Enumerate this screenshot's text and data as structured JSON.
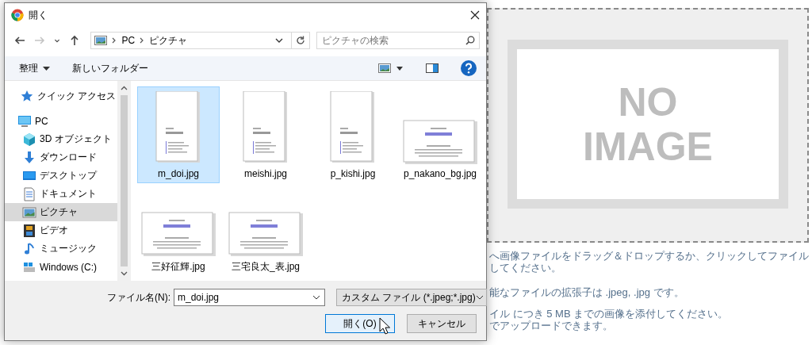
{
  "window": {
    "title": "開く"
  },
  "nav_buttons": [
    {
      "kind": "back",
      "disabled": false
    },
    {
      "kind": "forward",
      "disabled": true
    },
    {
      "kind": "recent",
      "disabled": false
    },
    {
      "kind": "up",
      "disabled": false
    }
  ],
  "address": {
    "path": [
      "PC",
      "ピクチャ"
    ]
  },
  "search": {
    "placeholder": "ピクチャの検索"
  },
  "toolbar": {
    "organize": "整理",
    "new_folder": "新しいフォルダー"
  },
  "sidebar": {
    "items": [
      {
        "label": "クイック アクセス",
        "kind": "star",
        "selected": false
      },
      {
        "label": "PC",
        "kind": "pc",
        "selected": false,
        "children": [
          {
            "label": "3D オブジェクト",
            "kind": "cube",
            "selected": false
          },
          {
            "label": "ダウンロード",
            "kind": "download",
            "selected": false
          },
          {
            "label": "デスクトップ",
            "kind": "desktop",
            "selected": false
          },
          {
            "label": "ドキュメント",
            "kind": "document",
            "selected": false
          },
          {
            "label": "ピクチャ",
            "kind": "pictures",
            "selected": true
          },
          {
            "label": "ビデオ",
            "kind": "video",
            "selected": false
          },
          {
            "label": "ミュージック",
            "kind": "music",
            "selected": false
          },
          {
            "label": "Windows (C:)",
            "kind": "drive",
            "selected": false
          }
        ]
      }
    ]
  },
  "files": [
    {
      "name": "m_doi.jpg",
      "kind": "portrait",
      "selected": true
    },
    {
      "name": "meishi.jpg",
      "kind": "portrait",
      "selected": false
    },
    {
      "name": "p_kishi.jpg",
      "kind": "portrait",
      "selected": false
    },
    {
      "name": "p_nakano_bg.jpg",
      "kind": "landscape",
      "selected": false
    },
    {
      "name": "三好征輝.jpg",
      "kind": "landscape",
      "selected": false
    },
    {
      "name": "三宅良太_表.jpg",
      "kind": "landscape",
      "selected": false
    }
  ],
  "footer": {
    "filename_label": "ファイル名(N):",
    "filename": "m_doi.jpg",
    "filter": "カスタム ファイル (*.jpeg;*.jpg)",
    "buttons": [
      {
        "label": "開く(O)",
        "hovered": true
      },
      {
        "label": "キャンセル",
        "hovered": false
      }
    ]
  },
  "background_page": {
    "image_placeholder": [
      "NO",
      "IMAGE"
    ],
    "notes": [
      "へ画像ファイルをドラッグ＆ドロップするか、クリックしてファイル",
      "してください。",
      "能なファイルの拡張子は .jpeg, .jpg です。",
      "イル につき 5 MB までの画像を添付してください。",
      "でアップロードできます。"
    ]
  }
}
